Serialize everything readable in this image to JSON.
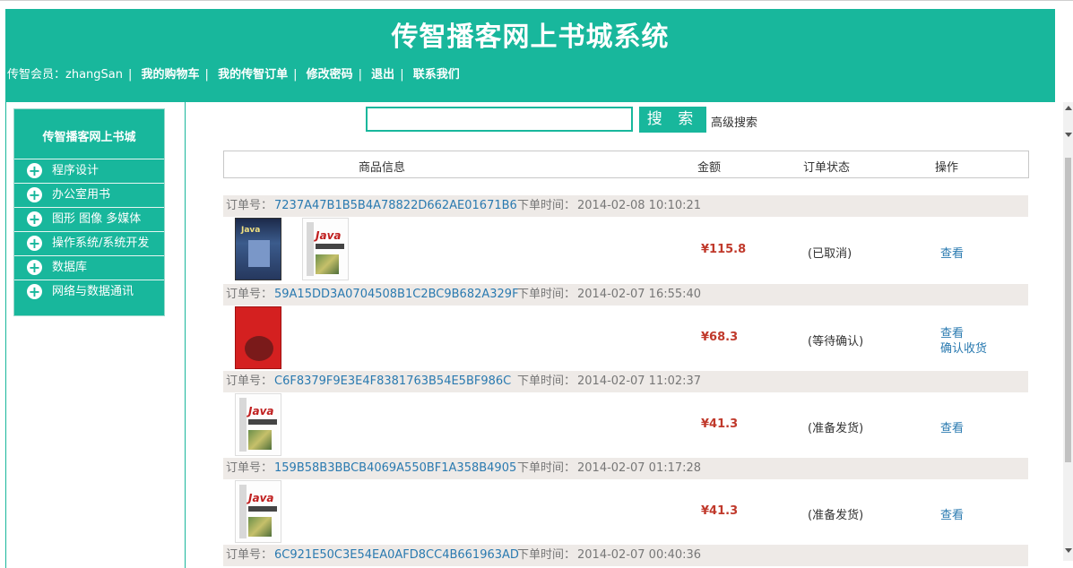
{
  "header": {
    "title": "传智播客网上书城系统",
    "member_prefix": "传智会员：",
    "username": "zhangSan",
    "links": [
      "我的购物车",
      "我的传智订单",
      "修改密码",
      "退出",
      "联系我们"
    ]
  },
  "sidebar": {
    "title": "传智播客网上书城",
    "categories": [
      "程序设计",
      "办公室用书",
      "图形 图像 多媒体",
      "操作系统/系统开发",
      "数据库",
      "网络与数据通讯"
    ]
  },
  "search": {
    "value": "",
    "button": "搜 索",
    "advanced": "高级搜索"
  },
  "table": {
    "headers": [
      "商品信息",
      "金额",
      "订单状态",
      "操作"
    ],
    "order_label": "订单号：",
    "time_label": "下单时间："
  },
  "orders": [
    {
      "id": "7237A47B1B5B4A78822D662AE01671B6",
      "time": "2014-02-08 10:10:21",
      "price": "¥115.8",
      "status": "(已取消)",
      "actions": [
        "查看"
      ]
    },
    {
      "id": "59A15DD3A0704508B1C2BC9B682A329F",
      "time": "2014-02-07 16:55:40",
      "price": "¥68.3",
      "status": "(等待确认)",
      "actions": [
        "查看",
        "确认收货"
      ]
    },
    {
      "id": "C6F8379F9E3E4F8381763B54E5BF986C",
      "time": "2014-02-07 11:02:37",
      "price": "¥41.3",
      "status": "(准备发货)",
      "actions": [
        "查看"
      ]
    },
    {
      "id": "159B58B3BBCB4069A550BF1A358B4905",
      "time": "2014-02-07 01:17:28",
      "price": "¥41.3",
      "status": "(准备发货)",
      "actions": [
        "查看"
      ]
    },
    {
      "id": "6C921E50C3E54EA0AFD8CC4B661963AD",
      "time": "2014-02-07 00:40:36"
    }
  ],
  "book_cover_text": {
    "java": "Java"
  }
}
